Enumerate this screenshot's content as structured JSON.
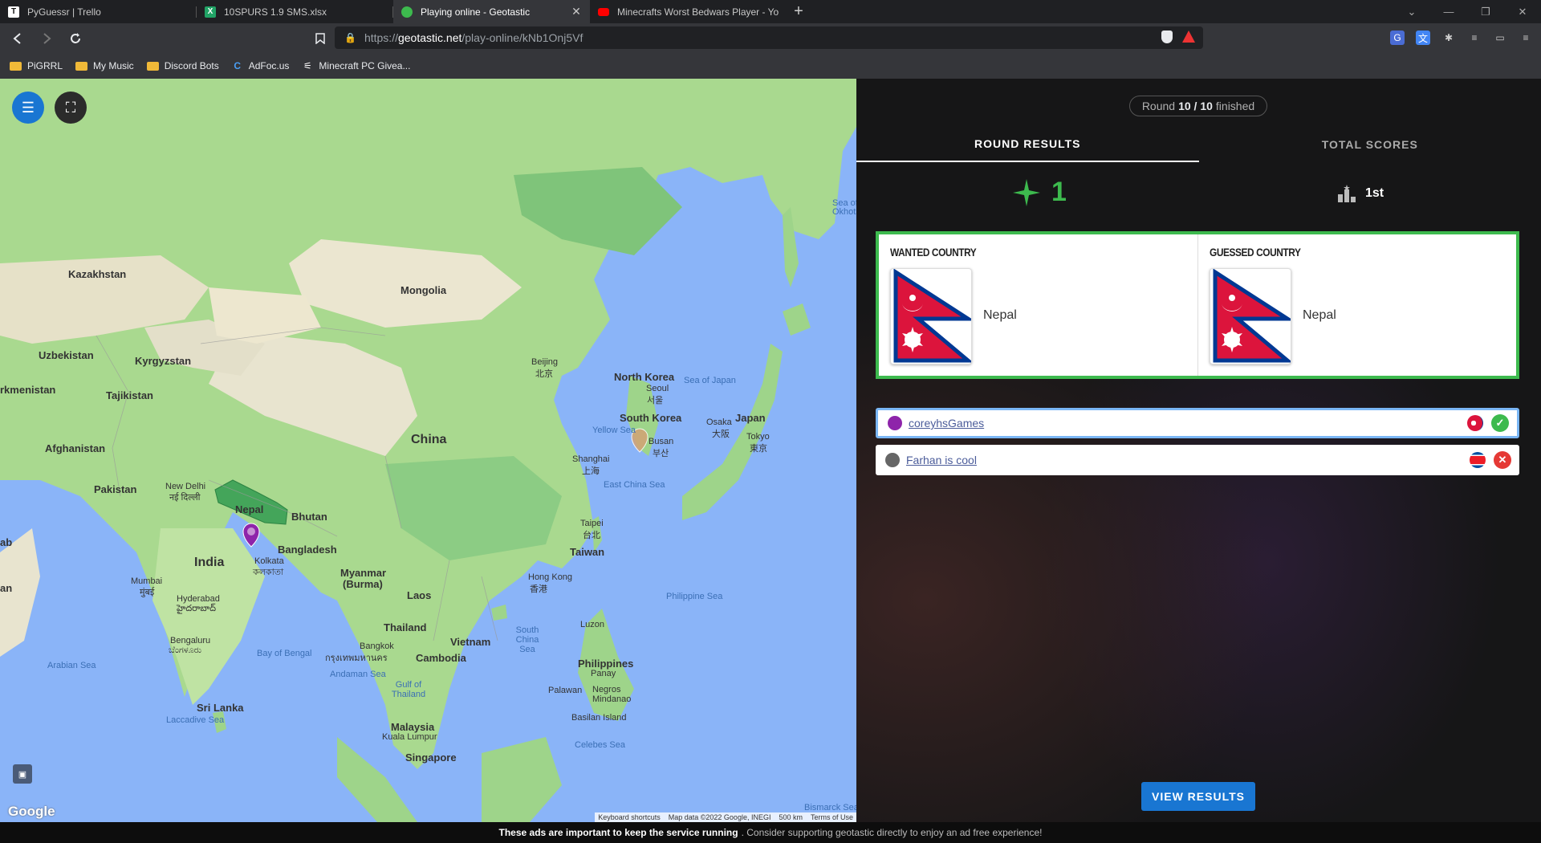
{
  "browser": {
    "tabs": [
      {
        "title": "PyGuessr | Trello",
        "icon": "trello-icon",
        "color": "#ffffff",
        "active": false
      },
      {
        "title": "10SPURS 1.9 SMS.xlsx",
        "icon": "excel-icon",
        "color": "#21a366",
        "active": false
      },
      {
        "title": "Playing online - Geotastic",
        "icon": "geotastic-icon",
        "color": "#3dba4e",
        "active": true
      },
      {
        "title": "Minecrafts Worst Bedwars Player - You",
        "icon": "youtube-icon",
        "color": "#ff0000",
        "active": false
      }
    ],
    "url": {
      "scheme": "https://",
      "host": "geotastic.net",
      "path": "/play-online/kNb1Onj5Vf"
    },
    "bookmarks": [
      {
        "label": "PiGRRL",
        "icon": "folder-icon"
      },
      {
        "label": "My Music",
        "icon": "folder-icon"
      },
      {
        "label": "Discord Bots",
        "icon": "folder-icon"
      },
      {
        "label": "AdFoc.us",
        "icon": "adfocus-icon"
      },
      {
        "label": "Minecraft PC Givea...",
        "icon": "steam-icon"
      }
    ]
  },
  "map": {
    "labels": {
      "kazakhstan": "Kazakhstan",
      "mongolia": "Mongolia",
      "uzbekistan": "Uzbekistan",
      "kyrgyzstan": "Kyrgyzstan",
      "turkmenistan": "rkmenistan",
      "tajikistan": "Tajikistan",
      "afghanistan": "Afghanistan",
      "pakistan": "Pakistan",
      "new_delhi": "New Delhi",
      "new_delhi_local": "नई दिल्ली",
      "nepal": "Nepal",
      "bhutan": "Bhutan",
      "china": "China",
      "india": "India",
      "bangladesh": "Bangladesh",
      "kolkata": "Kolkata",
      "kolkata_local": "কলকাতা",
      "myanmar": "Myanmar",
      "burma": "(Burma)",
      "laos": "Laos",
      "thailand": "Thailand",
      "bangkok": "Bangkok",
      "bangkok_local": "กรุงเทพมหานคร",
      "vietnam": "Vietnam",
      "cambodia": "Cambodia",
      "mumbai": "Mumbai",
      "mumbai_local": "मुंबई",
      "hyderabad": "Hyderabad",
      "hyderabad_local": "హైదరాబాద్",
      "bengaluru": "Bengaluru",
      "bengaluru_local": "ಬೆಂಗಳೂರು",
      "sri_lanka": "Sri Lanka",
      "malaysia": "Malaysia",
      "kuala_lumpur": "Kuala Lumpur",
      "singapore": "Singapore",
      "philippines": "Philippines",
      "panay": "Panay",
      "negros": "Negros",
      "mindanao": "Mindanao",
      "palawan": "Palawan",
      "luzon": "Luzon",
      "basilan": "Basilan Island",
      "beijing": "Beijing",
      "beijing_local": "北京",
      "north_korea": "North Korea",
      "seoul": "Seoul",
      "seoul_local": "서울",
      "south_korea": "South Korea",
      "busan": "Busan",
      "busan_local": "부산",
      "japan": "Japan",
      "osaka": "Osaka",
      "osaka_local": "大阪",
      "tokyo": "Tokyo",
      "tokyo_local": "東京",
      "shanghai": "Shanghai",
      "shanghai_local": "上海",
      "taipei": "Taipei",
      "taipei_local": "台北",
      "taiwan": "Taiwan",
      "hong_kong": "Hong Kong",
      "hong_kong_local": "香港",
      "sea_of_japan": "Sea of Japan",
      "yellow_sea": "Yellow Sea",
      "east_china_sea": "East China Sea",
      "philippine_sea": "Philippine Sea",
      "south_china_sea": "South China Sea",
      "bay_of_bengal": "Bay of Bengal",
      "arabian_sea": "Arabian Sea",
      "andaman_sea": "Andaman Sea",
      "gulf_of_thailand": "Gulf of Thailand",
      "laccadive_sea": "Laccadive Sea",
      "celebes_sea": "Celebes Sea",
      "sea_of_okhotsk": "Sea of Okhots",
      "bismarck_sea": "Bismarck Sea",
      "edge_ab": "ab",
      "edge_an": "an"
    },
    "google_logo": "Google",
    "attribution": [
      "Keyboard shortcuts",
      "Map data ©2022 Google, INEGI",
      "500 km",
      "Terms of Use"
    ]
  },
  "panel": {
    "round_prefix": "Round",
    "round_current": "10 / 10",
    "round_suffix": "finished",
    "tabs": [
      "ROUND RESULTS",
      "TOTAL SCORES"
    ],
    "score": "1",
    "rank": "1st",
    "wanted_label": "WANTED COUNTRY",
    "wanted_country": "Nepal",
    "guessed_label": "GUESSED COUNTRY",
    "guessed_country": "Nepal",
    "players": [
      {
        "name": "coreyhsGames",
        "avatar_color": "#8e24aa",
        "correct": true
      },
      {
        "name": "Farhan is cool",
        "avatar_color": "#666666",
        "correct": false
      }
    ],
    "view_results": "VIEW RESULTS",
    "colors": {
      "accent_green": "#3dba4e",
      "button_blue": "#1976d2",
      "error_red": "#e53935"
    }
  },
  "ad_bar": {
    "bold": "These ads are important to keep the service running",
    "rest": ". Consider supporting geotastic directly to enjoy an ad free experience!"
  }
}
